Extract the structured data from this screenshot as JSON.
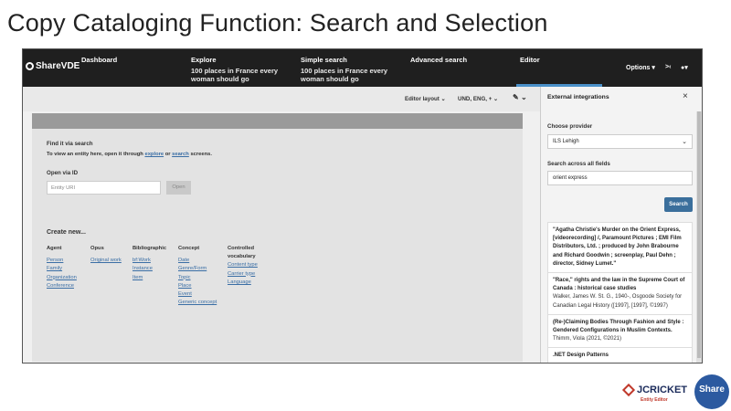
{
  "slide": {
    "title": "Copy Cataloging Function: Search and Selection"
  },
  "app": {
    "logo": "ShareVDE",
    "nav": [
      {
        "label": "Dashboard",
        "sub": ""
      },
      {
        "label": "Explore",
        "sub": "100 places in France every woman should go"
      },
      {
        "label": "Simple search",
        "sub": "100 places in France every woman should go"
      },
      {
        "label": "Advanced search",
        "sub": ""
      },
      {
        "label": "Editor",
        "sub": ""
      }
    ],
    "right": {
      "options": "Options",
      "expand": ">‹",
      "user": "▾"
    }
  },
  "toolbar": {
    "layout": "Editor layout",
    "langs": "UND, ENG, +",
    "pencil": "✎"
  },
  "editor": {
    "find_heading": "Find it via search",
    "find_text_a": "To view an entity here, open it through ",
    "find_link_explore": "explore",
    "find_text_b": " or ",
    "find_link_search": "search",
    "find_text_c": " screens.",
    "open_heading": "Open via ID",
    "uri_placeholder": "Entity URI",
    "open_button": "Open",
    "create_heading": "Create new...",
    "columns": [
      {
        "title": "Agent",
        "items": [
          "Person",
          "Family",
          "Organization",
          "Conference"
        ]
      },
      {
        "title": "Opus",
        "items": [
          "Original work"
        ]
      },
      {
        "title": "Bibliographic",
        "items": [
          "bf:Work",
          "Instance",
          "Item"
        ]
      },
      {
        "title": "Concept",
        "items": [
          "Date",
          "Genre/Form",
          "Topic",
          "Place",
          "Event",
          "Generic concept"
        ]
      },
      {
        "title": "Controlled vocabulary",
        "items": [
          "Content type",
          "Carrier type",
          "Language"
        ]
      }
    ]
  },
  "panel": {
    "title": "External integrations",
    "provider_label": "Choose provider",
    "provider_value": "ILS Lehigh",
    "search_label": "Search across all fields",
    "search_value": "orient express",
    "search_button": "Search",
    "results": [
      {
        "title": "\"Agatha Christie's Murder on the Orient Express, [videorecording] /, Paramount Pictures ; EMI Film Distributors, Ltd. ; produced by John Brabourne and Richard Goodwin ; screenplay, Paul Dehn ; director, Sidney Lumet.\"",
        "meta": ""
      },
      {
        "title": "\"Race,\" rights and the law in the Supreme Court of Canada : historical case studies",
        "meta": "Walker, James W. St. G., 1940-, Osgoode Society for Canadian Legal History ([1997], [1997], ©1997)"
      },
      {
        "title": "(Re-)Claiming Bodies Through Fashion and Style : Gendered Configurations in Muslim Contexts.",
        "meta": "Thimm, Viola (2021, ©2021)"
      },
      {
        "title": ".NET Design Patterns",
        "meta": ""
      }
    ]
  },
  "footer": {
    "jcricket": "JCRICKET",
    "jcricket_sub": "Entity Editor",
    "share": "Share",
    "share_sub": "FAMILY"
  },
  "colors": {
    "nav_bg": "#1f1f1f",
    "accent": "#3b6f9c",
    "link": "#3a6ea5"
  }
}
